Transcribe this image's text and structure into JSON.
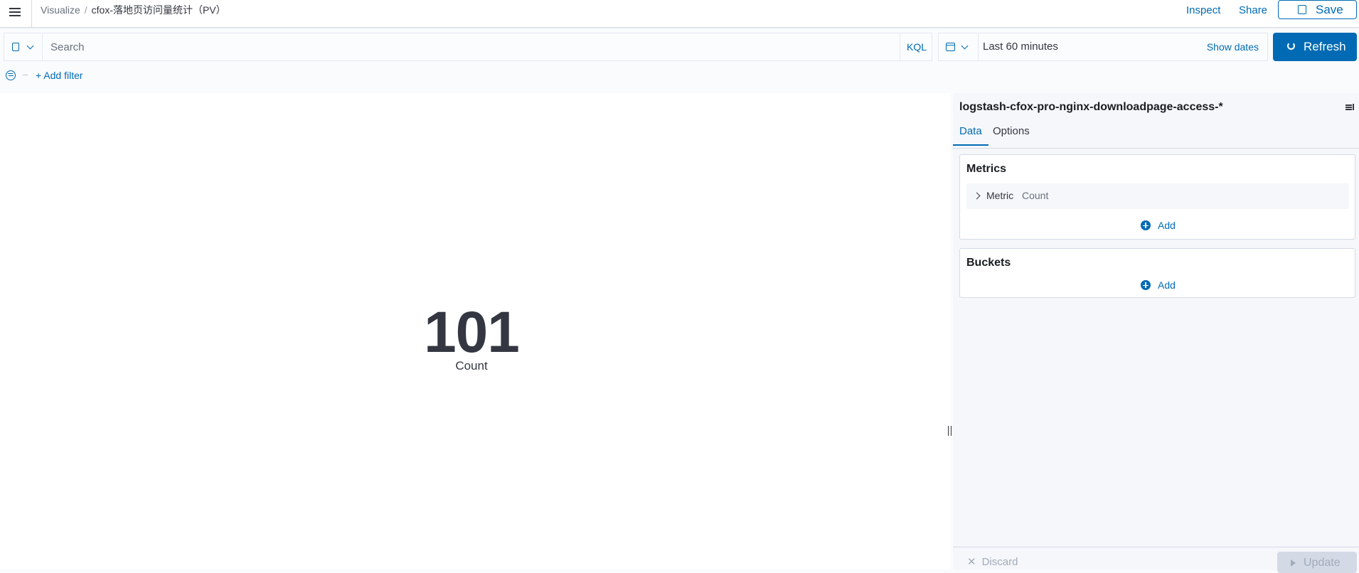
{
  "header": {
    "breadcrumb_root": "Visualize",
    "breadcrumb_separator": "/",
    "breadcrumb_current": "cfox-落地页访问量统计（PV）",
    "inspect_label": "Inspect",
    "share_label": "Share",
    "save_label": "Save"
  },
  "query": {
    "search_placeholder": "Search",
    "search_value": "",
    "language_label": "KQL",
    "time_range": "Last 60 minutes",
    "show_dates_label": "Show dates",
    "refresh_label": "Refresh"
  },
  "filters": {
    "add_filter_label": "+ Add filter"
  },
  "visualization": {
    "metric_value": "101",
    "metric_label": "Count"
  },
  "sidebar": {
    "index_pattern": "logstash-cfox-pro-nginx-downloadpage-access-*",
    "tabs": [
      {
        "label": "Data",
        "active": true
      },
      {
        "label": "Options",
        "active": false
      }
    ],
    "metrics_title": "Metrics",
    "metric_agg_type": "Metric",
    "metric_agg_name": "Count",
    "metrics_add_label": "Add",
    "buckets_title": "Buckets",
    "buckets_add_label": "Add",
    "discard_label": "Discard",
    "update_label": "Update"
  },
  "colors": {
    "accent": "#006bb4",
    "text": "#343741",
    "panel_bg": "#f5f7fa"
  },
  "icons": [
    "menu-icon",
    "save-icon",
    "query-save-icon",
    "calendar-icon",
    "refresh-icon",
    "filter-icon",
    "collapse-sidebar-icon",
    "chevron-right-icon",
    "plus-circle-icon",
    "close-icon",
    "play-icon"
  ]
}
